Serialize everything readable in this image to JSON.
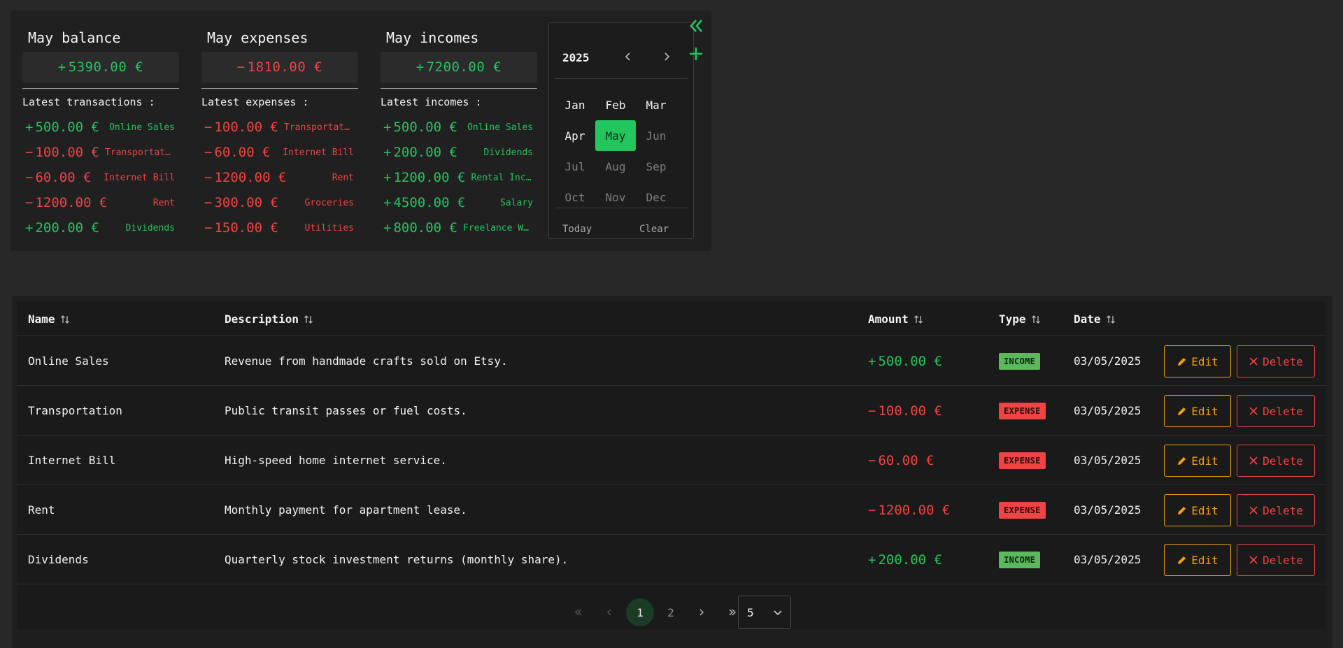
{
  "colors": {
    "income": "#22c55e",
    "expense": "#ef4444",
    "edit": "#f59e0b",
    "selected_month": "#22c55e"
  },
  "currency": "€",
  "summary": {
    "balance": {
      "title": "May balance",
      "sign": "+",
      "total": "5390.00",
      "latest_label": "Latest transactions :",
      "items": [
        {
          "sign": "+",
          "amount": "500.00",
          "name": "Online Sales",
          "kind": "income"
        },
        {
          "sign": "−",
          "amount": "100.00",
          "name": "Transportation",
          "kind": "expense"
        },
        {
          "sign": "−",
          "amount": "60.00",
          "name": "Internet Bill",
          "kind": "expense"
        },
        {
          "sign": "−",
          "amount": "1200.00",
          "name": "Rent",
          "kind": "expense"
        },
        {
          "sign": "+",
          "amount": "200.00",
          "name": "Dividends",
          "kind": "income"
        }
      ]
    },
    "expenses": {
      "title": "May expenses",
      "sign": "−",
      "total": "1810.00",
      "latest_label": "Latest expenses :",
      "items": [
        {
          "sign": "−",
          "amount": "100.00",
          "name": "Transportation",
          "kind": "expense"
        },
        {
          "sign": "−",
          "amount": "60.00",
          "name": "Internet Bill",
          "kind": "expense"
        },
        {
          "sign": "−",
          "amount": "1200.00",
          "name": "Rent",
          "kind": "expense"
        },
        {
          "sign": "−",
          "amount": "300.00",
          "name": "Groceries",
          "kind": "expense"
        },
        {
          "sign": "−",
          "amount": "150.00",
          "name": "Utilities",
          "kind": "expense"
        }
      ]
    },
    "incomes": {
      "title": "May incomes",
      "sign": "+",
      "total": "7200.00",
      "latest_label": "Latest incomes :",
      "items": [
        {
          "sign": "+",
          "amount": "500.00",
          "name": "Online Sales",
          "kind": "income"
        },
        {
          "sign": "+",
          "amount": "200.00",
          "name": "Dividends",
          "kind": "income"
        },
        {
          "sign": "+",
          "amount": "1200.00",
          "name": "Rental Income",
          "kind": "income"
        },
        {
          "sign": "+",
          "amount": "4500.00",
          "name": "Salary",
          "kind": "income"
        },
        {
          "sign": "+",
          "amount": "800.00",
          "name": "Freelance Work",
          "kind": "income"
        }
      ]
    }
  },
  "calendar": {
    "year": "2025",
    "months": [
      "Jan",
      "Feb",
      "Mar",
      "Apr",
      "May",
      "Jun",
      "Jul",
      "Aug",
      "Sep",
      "Oct",
      "Nov",
      "Dec"
    ],
    "selected": "May",
    "available_through": "May",
    "today_label": "Today",
    "clear_label": "Clear"
  },
  "table": {
    "headers": {
      "name": "Name",
      "description": "Description",
      "amount": "Amount",
      "type": "Type",
      "date": "Date"
    },
    "edit_label": "Edit",
    "delete_label": "Delete",
    "rows": [
      {
        "name": "Online Sales",
        "description": "Revenue from handmade crafts sold on Etsy.",
        "sign": "+",
        "amount": "500.00",
        "type": "INCOME",
        "date": "03/05/2025"
      },
      {
        "name": "Transportation",
        "description": "Public transit passes or fuel costs.",
        "sign": "−",
        "amount": "100.00",
        "type": "EXPENSE",
        "date": "03/05/2025"
      },
      {
        "name": "Internet Bill",
        "description": "High-speed home internet service.",
        "sign": "−",
        "amount": "60.00",
        "type": "EXPENSE",
        "date": "03/05/2025"
      },
      {
        "name": "Rent",
        "description": "Monthly payment for apartment lease.",
        "sign": "−",
        "amount": "1200.00",
        "type": "EXPENSE",
        "date": "03/05/2025"
      },
      {
        "name": "Dividends",
        "description": "Quarterly stock investment returns (monthly share).",
        "sign": "+",
        "amount": "200.00",
        "type": "INCOME",
        "date": "03/05/2025"
      }
    ]
  },
  "pagination": {
    "pages": [
      "1",
      "2"
    ],
    "current": "1",
    "per_page": "5"
  }
}
